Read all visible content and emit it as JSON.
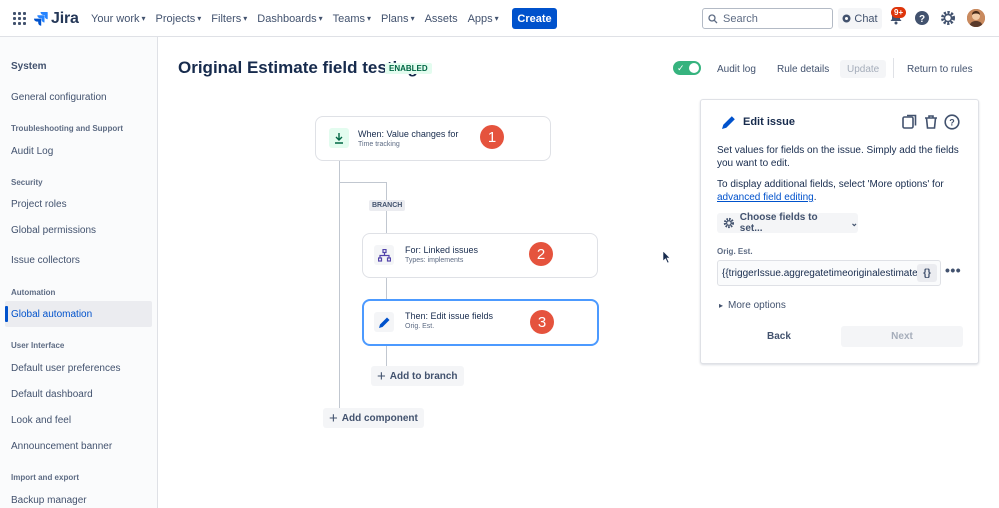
{
  "nav": {
    "logo_text": "Jira",
    "items": [
      {
        "label": "Your work"
      },
      {
        "label": "Projects"
      },
      {
        "label": "Filters"
      },
      {
        "label": "Dashboards"
      },
      {
        "label": "Teams"
      },
      {
        "label": "Plans"
      },
      {
        "label": "Assets"
      },
      {
        "label": "Apps"
      }
    ],
    "create_label": "Create",
    "search_placeholder": "Search",
    "chat_label": "Chat",
    "notification_count": "9+",
    "icons": [
      "app-switcher-icon",
      "search-icon",
      "notifications-icon",
      "help-icon",
      "settings-icon"
    ]
  },
  "sidebar": {
    "title": "System",
    "item_general": "General configuration",
    "head_troubleshooting": "Troubleshooting and Support",
    "item_audit": "Audit Log",
    "head_security": "Security",
    "item_project_roles": "Project roles",
    "item_global_permissions": "Global permissions",
    "item_issue_collectors": "Issue collectors",
    "head_automation": "Automation",
    "item_global_automation": "Global automation",
    "head_user_interface": "User Interface",
    "item_user_prefs": "Default user preferences",
    "item_dashboard": "Default dashboard",
    "item_look": "Look and feel",
    "item_banner": "Announcement banner",
    "head_import": "Import and export",
    "item_backup": "Backup manager"
  },
  "header": {
    "title": "Original Estimate field testing",
    "status": "ENABLED",
    "audit_log": "Audit log",
    "rule_details": "Rule details",
    "update": "Update",
    "return": "Return to rules"
  },
  "flow": {
    "trigger": {
      "title": "When: Value changes for",
      "sub": "Time tracking",
      "number": "1"
    },
    "branch_label": "BRANCH",
    "branch": {
      "title": "For: Linked issues",
      "sub": "Types: implements",
      "number": "2"
    },
    "action": {
      "title": "Then: Edit issue fields",
      "sub": "Orig. Est.",
      "number": "3"
    },
    "add_to_branch": "Add to branch",
    "add_component": "Add component"
  },
  "panel": {
    "title": "Edit issue",
    "desc1": "Set values for fields on the issue. Simply add the fields you want to edit.",
    "desc2_pre": "To display additional fields, select 'More options' for",
    "desc2_link": "advanced field editing",
    "desc2_post": ".",
    "choose_fields": "Choose fields to set...",
    "field_label": "Orig. Est.",
    "field_value": "{{triggerIssue.aggregatetimeoriginalestimate.",
    "braces": "{}",
    "more_options": "More options",
    "back": "Back",
    "next": "Next"
  },
  "colors": {
    "primary": "#0052cc",
    "enabled_green": "#36b37e",
    "badge_red": "#e5533d",
    "selected_border": "#4c9aff"
  }
}
